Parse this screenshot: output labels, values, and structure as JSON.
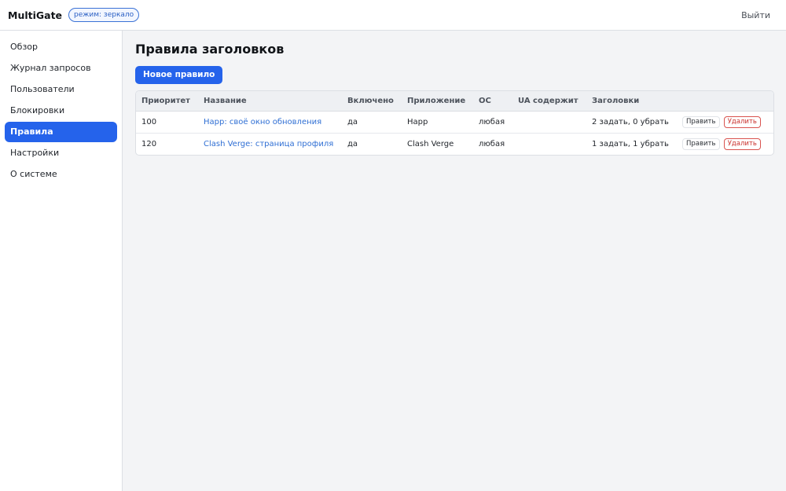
{
  "header": {
    "brand": "MultiGate",
    "mode_badge": "режим: зеркало",
    "logout": "Выйти"
  },
  "sidebar": {
    "items": [
      {
        "label": "Обзор"
      },
      {
        "label": "Журнал запросов"
      },
      {
        "label": "Пользователи"
      },
      {
        "label": "Блокировки"
      },
      {
        "label": "Правила заголовков",
        "active": true
      },
      {
        "label": "Настройки"
      },
      {
        "label": "О системе"
      }
    ]
  },
  "main": {
    "title": "Правила заголовков",
    "new_button": "Новое правило",
    "table": {
      "columns": [
        "Приоритет",
        "Название",
        "Включено",
        "Приложение",
        "ОС",
        "UA содержит",
        "Заголовки"
      ],
      "rows": [
        {
          "priority": "100",
          "name": "Happ: своё окно обновления",
          "enabled": "да",
          "app": "Happ",
          "os": "любая",
          "ua": "",
          "headers": "2 задать, 0 убрать",
          "edit": "Править",
          "delete": "Удалить"
        },
        {
          "priority": "120",
          "name": "Clash Verge: страница профиля",
          "enabled": "да",
          "app": "Clash Verge",
          "os": "любая",
          "ua": "",
          "headers": "1 задать, 1 убрать",
          "edit": "Править",
          "delete": "Удалить"
        }
      ]
    }
  },
  "colors": {
    "accent": "#2563eb",
    "danger": "#c9302c",
    "link": "#2f6fd4"
  }
}
